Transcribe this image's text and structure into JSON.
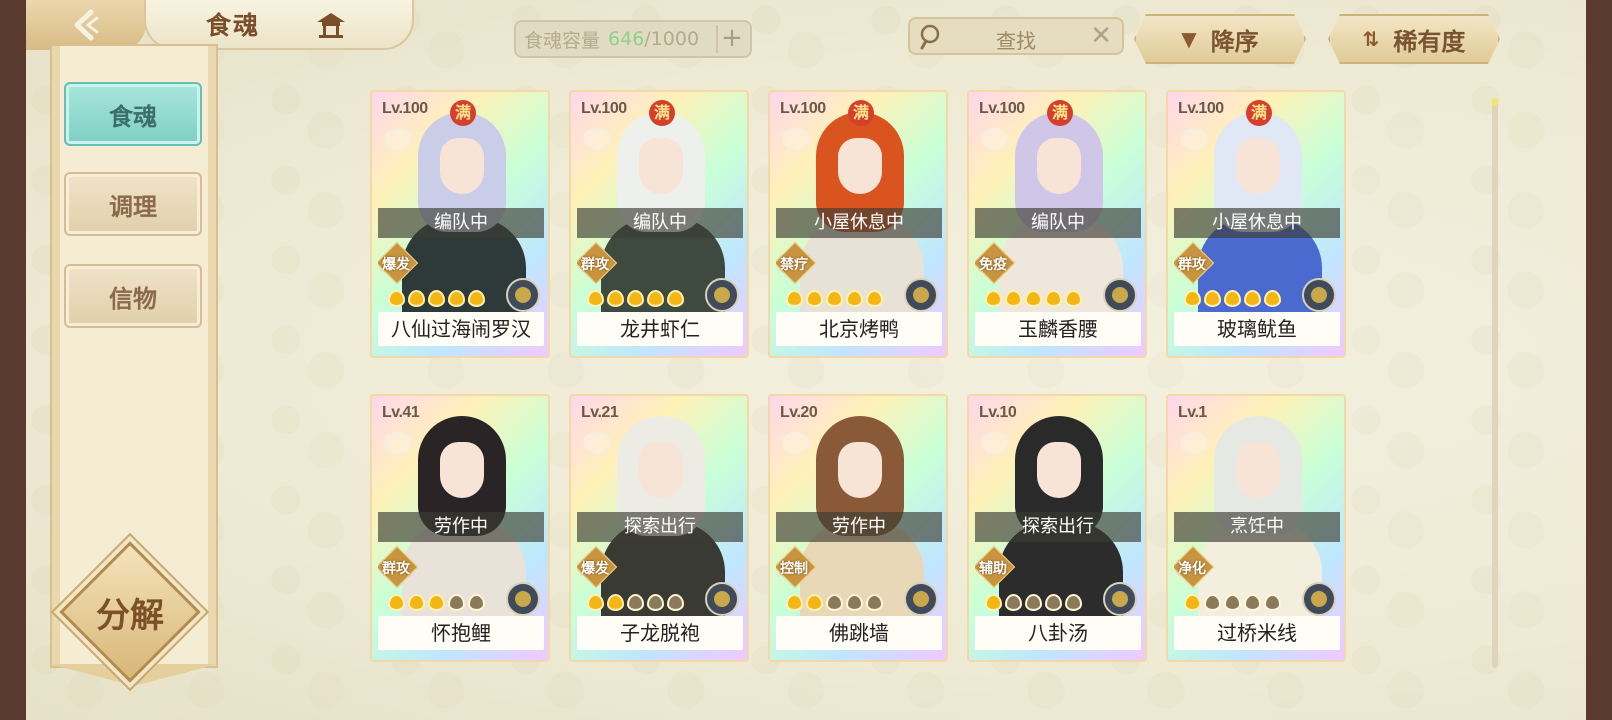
{
  "header": {
    "title": "食魂",
    "capacity_label": "食魂容量",
    "capacity_current": "646",
    "capacity_max": "/1000",
    "capacity_add": "+",
    "search_placeholder": "查找",
    "search_clear": "✕",
    "sort_order": "降序",
    "sort_rarity": "稀有度"
  },
  "sidebar": {
    "items": [
      {
        "label": "食魂",
        "active": true
      },
      {
        "label": "调理",
        "active": false
      },
      {
        "label": "信物",
        "active": false
      }
    ],
    "decompose": "分解"
  },
  "icons": {
    "back": "back-chevron-icon",
    "home": "pavilion-icon",
    "search": "magnifier-icon",
    "sort_order": "down-triangle-icon",
    "sort_rarity": "swap-arrows-icon",
    "card_type": "bowl-icon",
    "emblem": "flower-emblem-icon",
    "stars": "flame-star-icon"
  },
  "colors": {
    "accent_teal": "#7fcfc4",
    "capacity_current": "#8fd18a",
    "full_badge": "#d5402c",
    "star_on": "#f4b614"
  },
  "cards": [
    {
      "level": "Lv.100",
      "full": "满",
      "status": "编队中",
      "role": "爆发",
      "stars": 5,
      "name": "八仙过海闹罗汉"
    },
    {
      "level": "Lv.100",
      "full": "满",
      "status": "编队中",
      "role": "群攻",
      "stars": 5,
      "name": "龙井虾仁"
    },
    {
      "level": "Lv.100",
      "full": "满",
      "status": "小屋休息中",
      "role": "禁疗",
      "stars": 5,
      "name": "北京烤鸭"
    },
    {
      "level": "Lv.100",
      "full": "满",
      "status": "编队中",
      "role": "免疫",
      "stars": 5,
      "name": "玉麟香腰"
    },
    {
      "level": "Lv.100",
      "full": "满",
      "status": "小屋休息中",
      "role": "群攻",
      "stars": 5,
      "name": "玻璃鱿鱼"
    },
    {
      "level": "Lv.41",
      "full": "",
      "status": "劳作中",
      "role": "群攻",
      "stars": 3,
      "name": "怀抱鲤"
    },
    {
      "level": "Lv.21",
      "full": "",
      "status": "探索出行",
      "role": "爆发",
      "stars": 2,
      "name": "子龙脱袍"
    },
    {
      "level": "Lv.20",
      "full": "",
      "status": "劳作中",
      "role": "控制",
      "stars": 2,
      "name": "佛跳墙"
    },
    {
      "level": "Lv.10",
      "full": "",
      "status": "探索出行",
      "role": "辅助",
      "stars": 1,
      "name": "八卦汤"
    },
    {
      "level": "Lv.1",
      "full": "",
      "status": "烹饪中",
      "role": "净化",
      "stars": 1,
      "name": "过桥米线"
    }
  ]
}
